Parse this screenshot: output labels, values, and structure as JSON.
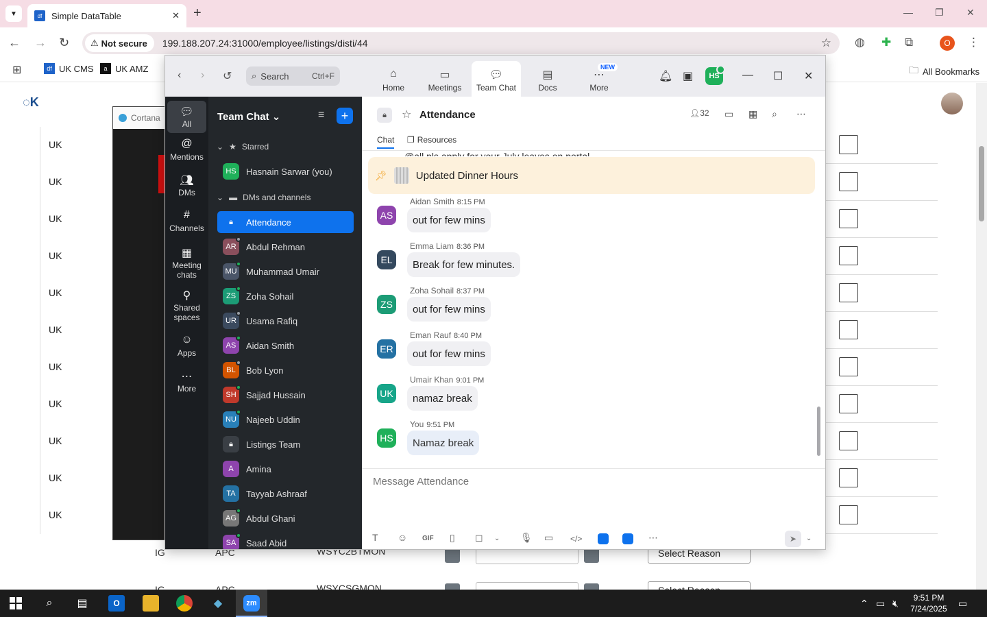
{
  "browser": {
    "tab_title": "Simple DataTable",
    "url": "199.188.207.24:31000/employee/listings/disti/44",
    "security_label": "Not secure",
    "bookmarks": [
      {
        "label": "UK CMS",
        "color": "#1e63c9",
        "glyph": "df"
      },
      {
        "label": "UK AMZ",
        "color": "#111111",
        "glyph": "a"
      }
    ],
    "all_bookmarks": "All Bookmarks",
    "profile_initial": "O"
  },
  "page": {
    "rows": [
      "UK",
      "UK",
      "UK",
      "UK",
      "UK",
      "UK",
      "UK",
      "UK",
      "UK",
      "UK",
      "UK",
      "UK",
      "UK"
    ],
    "partial_row": {
      "col1": "IG",
      "col2": "APC",
      "col3": "WSYC2BTMON",
      "select": "Select Reason"
    },
    "partial_row2": {
      "col1": "IG",
      "col2": "APC",
      "col3": "WSYCSGMON",
      "select": "Select Reason"
    }
  },
  "cortana": {
    "title": "Cortana"
  },
  "zoom": {
    "search_placeholder": "Search",
    "search_shortcut": "Ctrl+F",
    "tabs": [
      {
        "label": "Home",
        "icon": "home-icon"
      },
      {
        "label": "Meetings",
        "icon": "camera-icon"
      },
      {
        "label": "Team Chat",
        "icon": "chat-icon",
        "active": true
      },
      {
        "label": "Docs",
        "icon": "docs-icon"
      },
      {
        "label": "More",
        "icon": "more-icon",
        "badge": "NEW"
      }
    ],
    "user_initials": "HS",
    "left_nav": [
      {
        "label": "All",
        "active": true
      },
      {
        "label": "Mentions"
      },
      {
        "label": "DMs"
      },
      {
        "label": "Channels"
      },
      {
        "label": "Meeting chats"
      },
      {
        "label": "Shared spaces"
      },
      {
        "label": "Apps"
      },
      {
        "label": "More"
      }
    ],
    "list_title": "Team Chat",
    "starred_label": "Starred",
    "starred_item": {
      "initials": "HS",
      "name": "Hasnain Sarwar (you)",
      "color": "#1fb05a"
    },
    "dms_label": "DMs and channels",
    "items": [
      {
        "initials": "",
        "name": "Attendance",
        "color": "#0e72ed",
        "active": true,
        "lock": true
      },
      {
        "initials": "AR",
        "name": "Abdul Rehman",
        "color": "#8a4f5c",
        "status": "#9aa0a6"
      },
      {
        "initials": "MU",
        "name": "Muhammad Umair",
        "color": "#4a5568",
        "status": "#1fb05a"
      },
      {
        "initials": "ZS",
        "name": "Zoha Sohail",
        "color": "#1c9c76",
        "status": "#1fb05a"
      },
      {
        "initials": "UR",
        "name": "Usama Rafiq",
        "color": "#3b4a5e",
        "status": "#9aa0a6"
      },
      {
        "initials": "AS",
        "name": "Aidan Smith",
        "color": "#8e44ad",
        "status": "#1fb05a"
      },
      {
        "initials": "BL",
        "name": "Bob Lyon",
        "color": "#d35400",
        "status": "#9aa0a6"
      },
      {
        "initials": "SH",
        "name": "Sajjad Hussain",
        "color": "#c0392b",
        "status": "#1fb05a"
      },
      {
        "initials": "NU",
        "name": "Najeeb Uddin",
        "color": "#2980b9",
        "status": "#1fb05a"
      },
      {
        "initials": "",
        "name": "Listings Team",
        "color": "#3a3f45",
        "lock": true
      },
      {
        "initials": "A",
        "name": "Amina",
        "color": "#8e44ad"
      },
      {
        "initials": "TA",
        "name": "Tayyab Ashraaf",
        "color": "#2471a3"
      },
      {
        "initials": "AG",
        "name": "Abdul Ghani",
        "color": "#777777",
        "status": "#1fb05a"
      },
      {
        "initials": "SA",
        "name": "Saad Abid",
        "color": "#8e44ad",
        "status": "#1fb05a"
      }
    ],
    "channel": {
      "title": "Attendance",
      "member_count": "32",
      "subtabs": [
        "Chat",
        "Resources"
      ],
      "clipped_text": "@all pls apply for your July leaves on portal",
      "pinned": "Updated Dinner Hours",
      "messages": [
        {
          "initials": "AS",
          "author": "Aidan Smith",
          "time": "8:15 PM",
          "text": "out for few mins",
          "color": "#8e44ad"
        },
        {
          "initials": "EL",
          "author": "Emma Liam",
          "time": "8:36 PM",
          "text": "Break for few minutes.",
          "color": "#34495e"
        },
        {
          "initials": "ZS",
          "author": "Zoha Sohail",
          "time": "8:37 PM",
          "text": "out for few mins",
          "color": "#1c9c76"
        },
        {
          "initials": "ER",
          "author": "Eman Rauf",
          "time": "8:40 PM",
          "text": "out for few mins",
          "color": "#2471a3"
        },
        {
          "initials": "UK",
          "author": "Umair Khan",
          "time": "9:01 PM",
          "text": "namaz break",
          "color": "#17a589"
        },
        {
          "initials": "HS",
          "author": "You",
          "time": "9:51 PM",
          "text": "Namaz break",
          "color": "#1fb05a",
          "you": true
        }
      ],
      "compose_placeholder": "Message Attendance"
    }
  },
  "taskbar": {
    "time": "9:51 PM",
    "date": "7/24/2025",
    "zoom_label": "zm"
  }
}
